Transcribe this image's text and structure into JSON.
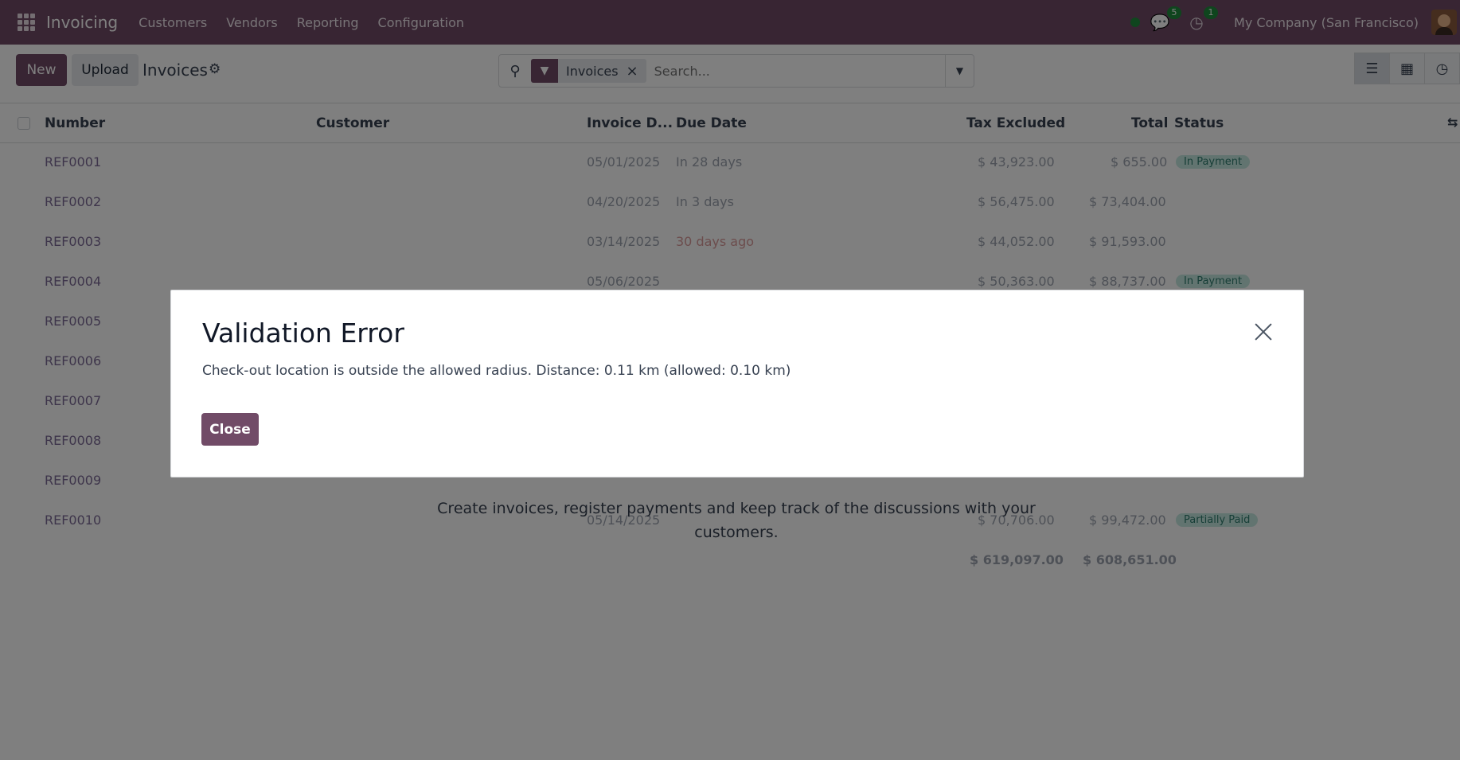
{
  "navbar": {
    "app_name": "Invoicing",
    "menu": [
      "Customers",
      "Vendors",
      "Reporting",
      "Configuration"
    ],
    "messages_count": "5",
    "activities_count": "1",
    "company": "My Company (San Francisco)"
  },
  "control": {
    "new_label": "New",
    "upload_label": "Upload",
    "title": "Invoices",
    "facet_label": "Invoices",
    "search_placeholder": "Search..."
  },
  "list": {
    "columns": {
      "number": "Number",
      "customer": "Customer",
      "invoice_date": "Invoice D...",
      "due_date": "Due Date",
      "tax_excluded": "Tax Excluded",
      "total": "Total",
      "status": "Status"
    },
    "rows": [
      {
        "ref": "REF0001",
        "date": "05/01/2025",
        "due": "In 28 days",
        "tax": "$ 43,923.00",
        "total": "$ 655.00",
        "status": "In Payment"
      },
      {
        "ref": "REF0002",
        "date": "04/20/2025",
        "due": "In 3 days",
        "tax": "$ 56,475.00",
        "total": "$ 73,404.00",
        "status": ""
      },
      {
        "ref": "REF0003",
        "date": "03/14/2025",
        "due": "30 days ago",
        "tax": "$ 44,052.00",
        "total": "$ 91,593.00",
        "status": ""
      },
      {
        "ref": "REF0004",
        "date": "05/06/2025",
        "due": "",
        "tax": "$ 50,363.00",
        "total": "$ 88,737.00",
        "status": "In Payment"
      },
      {
        "ref": "REF0005",
        "date": "",
        "due": "",
        "tax": "",
        "total": "",
        "status": ""
      },
      {
        "ref": "REF0006",
        "date": "",
        "due": "",
        "tax": "",
        "total": "",
        "status": ""
      },
      {
        "ref": "REF0007",
        "date": "",
        "due": "",
        "tax": "",
        "total": "",
        "status": ""
      },
      {
        "ref": "REF0008",
        "date": "",
        "due": "",
        "tax": "",
        "total": "",
        "status": ""
      },
      {
        "ref": "REF0009",
        "date": "",
        "due": "",
        "tax": "",
        "total": "",
        "status": ""
      },
      {
        "ref": "REF0010",
        "date": "05/14/2025",
        "due": "",
        "tax": "$ 70,706.00",
        "total": "$ 99,472.00",
        "status": "Partially Paid"
      }
    ],
    "sum_tax": "$ 619,097.00",
    "sum_total": "$ 608,651.00",
    "help_text": "Create invoices, register payments and keep track of the discussions with your customers."
  },
  "dialog": {
    "title": "Validation Error",
    "message": "Check-out location is outside the allowed radius. Distance: 0.11 km (allowed: 0.10 km)",
    "close_label": "Close"
  }
}
